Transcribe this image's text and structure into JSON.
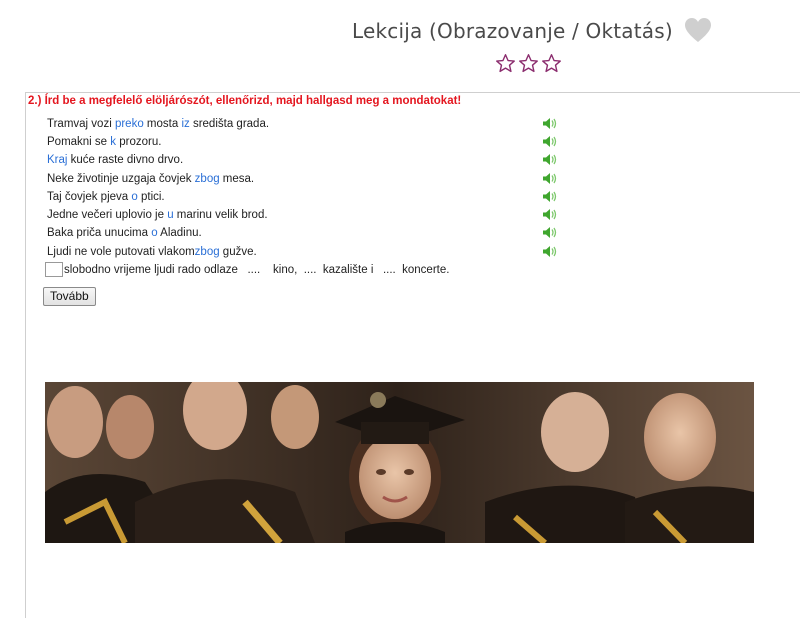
{
  "header": {
    "title": "Lekcija (Obrazovanje / Oktatás)",
    "favorite_icon": "heart-icon",
    "rating_stars": 3,
    "rating_value": 0
  },
  "exercise": {
    "instruction": "2.) Írd be a megfelelő elöljárószót, ellenőrizd, majd hallgasd meg a mondatokat!",
    "rows": [
      {
        "parts": [
          "Tramvaj vozi ",
          "preko",
          " mosta ",
          "iz",
          " središta grada."
        ]
      },
      {
        "parts": [
          "Pomakni se ",
          "k",
          " prozoru."
        ]
      },
      {
        "parts": [
          "",
          "Kraj",
          " kuće raste divno drvo."
        ]
      },
      {
        "parts": [
          "Neke životinje uzgaja čovjek ",
          "zbog",
          " mesa."
        ]
      },
      {
        "parts": [
          "Taj čovjek pjeva ",
          "o",
          " ptici."
        ]
      },
      {
        "parts": [
          "Jedne večeri uplovio je ",
          "u",
          " marinu velik brod."
        ]
      },
      {
        "parts": [
          "Baka priča unucima ",
          "o",
          " Aladinu."
        ]
      },
      {
        "parts": [
          "Ljudi ne vole putovati vlakom",
          "zbog",
          " gužve."
        ]
      }
    ],
    "current_row_text": "slobodno vrijeme ljudi rado odlaze   ....    kino,  ....  kazalište i   ....  koncerte.",
    "input_value": "",
    "next_button": "Tovább"
  },
  "colors": {
    "instruction": "#e4161f",
    "answer": "#2a6fd6",
    "title": "#4a4a4a",
    "star": "#8b2d6e",
    "speaker": "#3fa62e"
  }
}
